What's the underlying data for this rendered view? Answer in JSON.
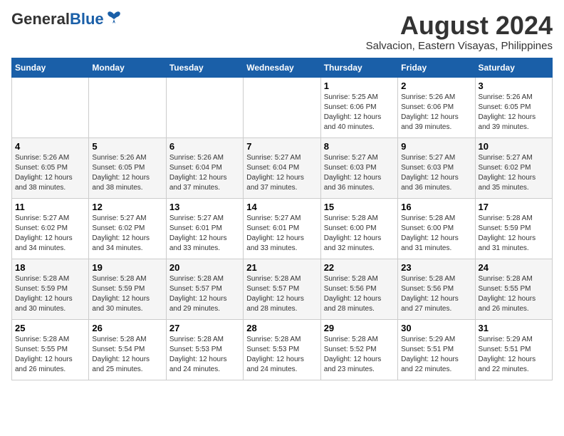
{
  "header": {
    "logo_general": "General",
    "logo_blue": "Blue",
    "month_year": "August 2024",
    "location": "Salvacion, Eastern Visayas, Philippines"
  },
  "weekdays": [
    "Sunday",
    "Monday",
    "Tuesday",
    "Wednesday",
    "Thursday",
    "Friday",
    "Saturday"
  ],
  "weeks": [
    [
      {
        "day": "",
        "sunrise": "",
        "sunset": "",
        "daylight": ""
      },
      {
        "day": "",
        "sunrise": "",
        "sunset": "",
        "daylight": ""
      },
      {
        "day": "",
        "sunrise": "",
        "sunset": "",
        "daylight": ""
      },
      {
        "day": "",
        "sunrise": "",
        "sunset": "",
        "daylight": ""
      },
      {
        "day": "1",
        "sunrise": "5:25 AM",
        "sunset": "6:06 PM",
        "daylight": "12 hours and 40 minutes."
      },
      {
        "day": "2",
        "sunrise": "5:26 AM",
        "sunset": "6:06 PM",
        "daylight": "12 hours and 39 minutes."
      },
      {
        "day": "3",
        "sunrise": "5:26 AM",
        "sunset": "6:05 PM",
        "daylight": "12 hours and 39 minutes."
      }
    ],
    [
      {
        "day": "4",
        "sunrise": "5:26 AM",
        "sunset": "6:05 PM",
        "daylight": "12 hours and 38 minutes."
      },
      {
        "day": "5",
        "sunrise": "5:26 AM",
        "sunset": "6:05 PM",
        "daylight": "12 hours and 38 minutes."
      },
      {
        "day": "6",
        "sunrise": "5:26 AM",
        "sunset": "6:04 PM",
        "daylight": "12 hours and 37 minutes."
      },
      {
        "day": "7",
        "sunrise": "5:27 AM",
        "sunset": "6:04 PM",
        "daylight": "12 hours and 37 minutes."
      },
      {
        "day": "8",
        "sunrise": "5:27 AM",
        "sunset": "6:03 PM",
        "daylight": "12 hours and 36 minutes."
      },
      {
        "day": "9",
        "sunrise": "5:27 AM",
        "sunset": "6:03 PM",
        "daylight": "12 hours and 36 minutes."
      },
      {
        "day": "10",
        "sunrise": "5:27 AM",
        "sunset": "6:02 PM",
        "daylight": "12 hours and 35 minutes."
      }
    ],
    [
      {
        "day": "11",
        "sunrise": "5:27 AM",
        "sunset": "6:02 PM",
        "daylight": "12 hours and 34 minutes."
      },
      {
        "day": "12",
        "sunrise": "5:27 AM",
        "sunset": "6:02 PM",
        "daylight": "12 hours and 34 minutes."
      },
      {
        "day": "13",
        "sunrise": "5:27 AM",
        "sunset": "6:01 PM",
        "daylight": "12 hours and 33 minutes."
      },
      {
        "day": "14",
        "sunrise": "5:27 AM",
        "sunset": "6:01 PM",
        "daylight": "12 hours and 33 minutes."
      },
      {
        "day": "15",
        "sunrise": "5:28 AM",
        "sunset": "6:00 PM",
        "daylight": "12 hours and 32 minutes."
      },
      {
        "day": "16",
        "sunrise": "5:28 AM",
        "sunset": "6:00 PM",
        "daylight": "12 hours and 31 minutes."
      },
      {
        "day": "17",
        "sunrise": "5:28 AM",
        "sunset": "5:59 PM",
        "daylight": "12 hours and 31 minutes."
      }
    ],
    [
      {
        "day": "18",
        "sunrise": "5:28 AM",
        "sunset": "5:59 PM",
        "daylight": "12 hours and 30 minutes."
      },
      {
        "day": "19",
        "sunrise": "5:28 AM",
        "sunset": "5:59 PM",
        "daylight": "12 hours and 30 minutes."
      },
      {
        "day": "20",
        "sunrise": "5:28 AM",
        "sunset": "5:57 PM",
        "daylight": "12 hours and 29 minutes."
      },
      {
        "day": "21",
        "sunrise": "5:28 AM",
        "sunset": "5:57 PM",
        "daylight": "12 hours and 28 minutes."
      },
      {
        "day": "22",
        "sunrise": "5:28 AM",
        "sunset": "5:56 PM",
        "daylight": "12 hours and 28 minutes."
      },
      {
        "day": "23",
        "sunrise": "5:28 AM",
        "sunset": "5:56 PM",
        "daylight": "12 hours and 27 minutes."
      },
      {
        "day": "24",
        "sunrise": "5:28 AM",
        "sunset": "5:55 PM",
        "daylight": "12 hours and 26 minutes."
      }
    ],
    [
      {
        "day": "25",
        "sunrise": "5:28 AM",
        "sunset": "5:55 PM",
        "daylight": "12 hours and 26 minutes."
      },
      {
        "day": "26",
        "sunrise": "5:28 AM",
        "sunset": "5:54 PM",
        "daylight": "12 hours and 25 minutes."
      },
      {
        "day": "27",
        "sunrise": "5:28 AM",
        "sunset": "5:53 PM",
        "daylight": "12 hours and 24 minutes."
      },
      {
        "day": "28",
        "sunrise": "5:28 AM",
        "sunset": "5:53 PM",
        "daylight": "12 hours and 24 minutes."
      },
      {
        "day": "29",
        "sunrise": "5:28 AM",
        "sunset": "5:52 PM",
        "daylight": "12 hours and 23 minutes."
      },
      {
        "day": "30",
        "sunrise": "5:29 AM",
        "sunset": "5:51 PM",
        "daylight": "12 hours and 22 minutes."
      },
      {
        "day": "31",
        "sunrise": "5:29 AM",
        "sunset": "5:51 PM",
        "daylight": "12 hours and 22 minutes."
      }
    ]
  ]
}
